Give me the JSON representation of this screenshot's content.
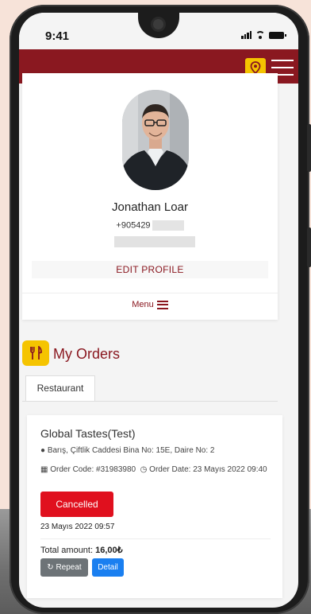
{
  "status_bar": {
    "time": "9:41"
  },
  "colors": {
    "brand": "#8a1820",
    "accent": "#f5c400",
    "danger": "#e0101e",
    "primary": "#1a7ff0",
    "secondary": "#6d7377"
  },
  "header": {
    "location_icon": "location-pin-icon",
    "menu_icon": "hamburger-menu-icon"
  },
  "profile": {
    "name": "Jonathan Loar",
    "phone": "+905429",
    "edit_label": "EDIT PROFILE",
    "menu_label": "Menu"
  },
  "orders": {
    "title": "My Orders",
    "tab_label": "Restaurant",
    "items": [
      {
        "restaurant": "Global Tastes(Test)",
        "address": "Barış, Çiftlik Caddesi Bina No: 15E, Daire No: 2",
        "order_code": "Order Code: #31983980",
        "order_date": "Order Date: 23 Mayıs 2022 09:40",
        "status": "Cancelled",
        "status_date": "23 Mayıs 2022 09:57",
        "total_label": "Total amount:",
        "total_value": "16,00₺",
        "repeat_label": "Repeat",
        "detail_label": "Detail"
      }
    ]
  }
}
